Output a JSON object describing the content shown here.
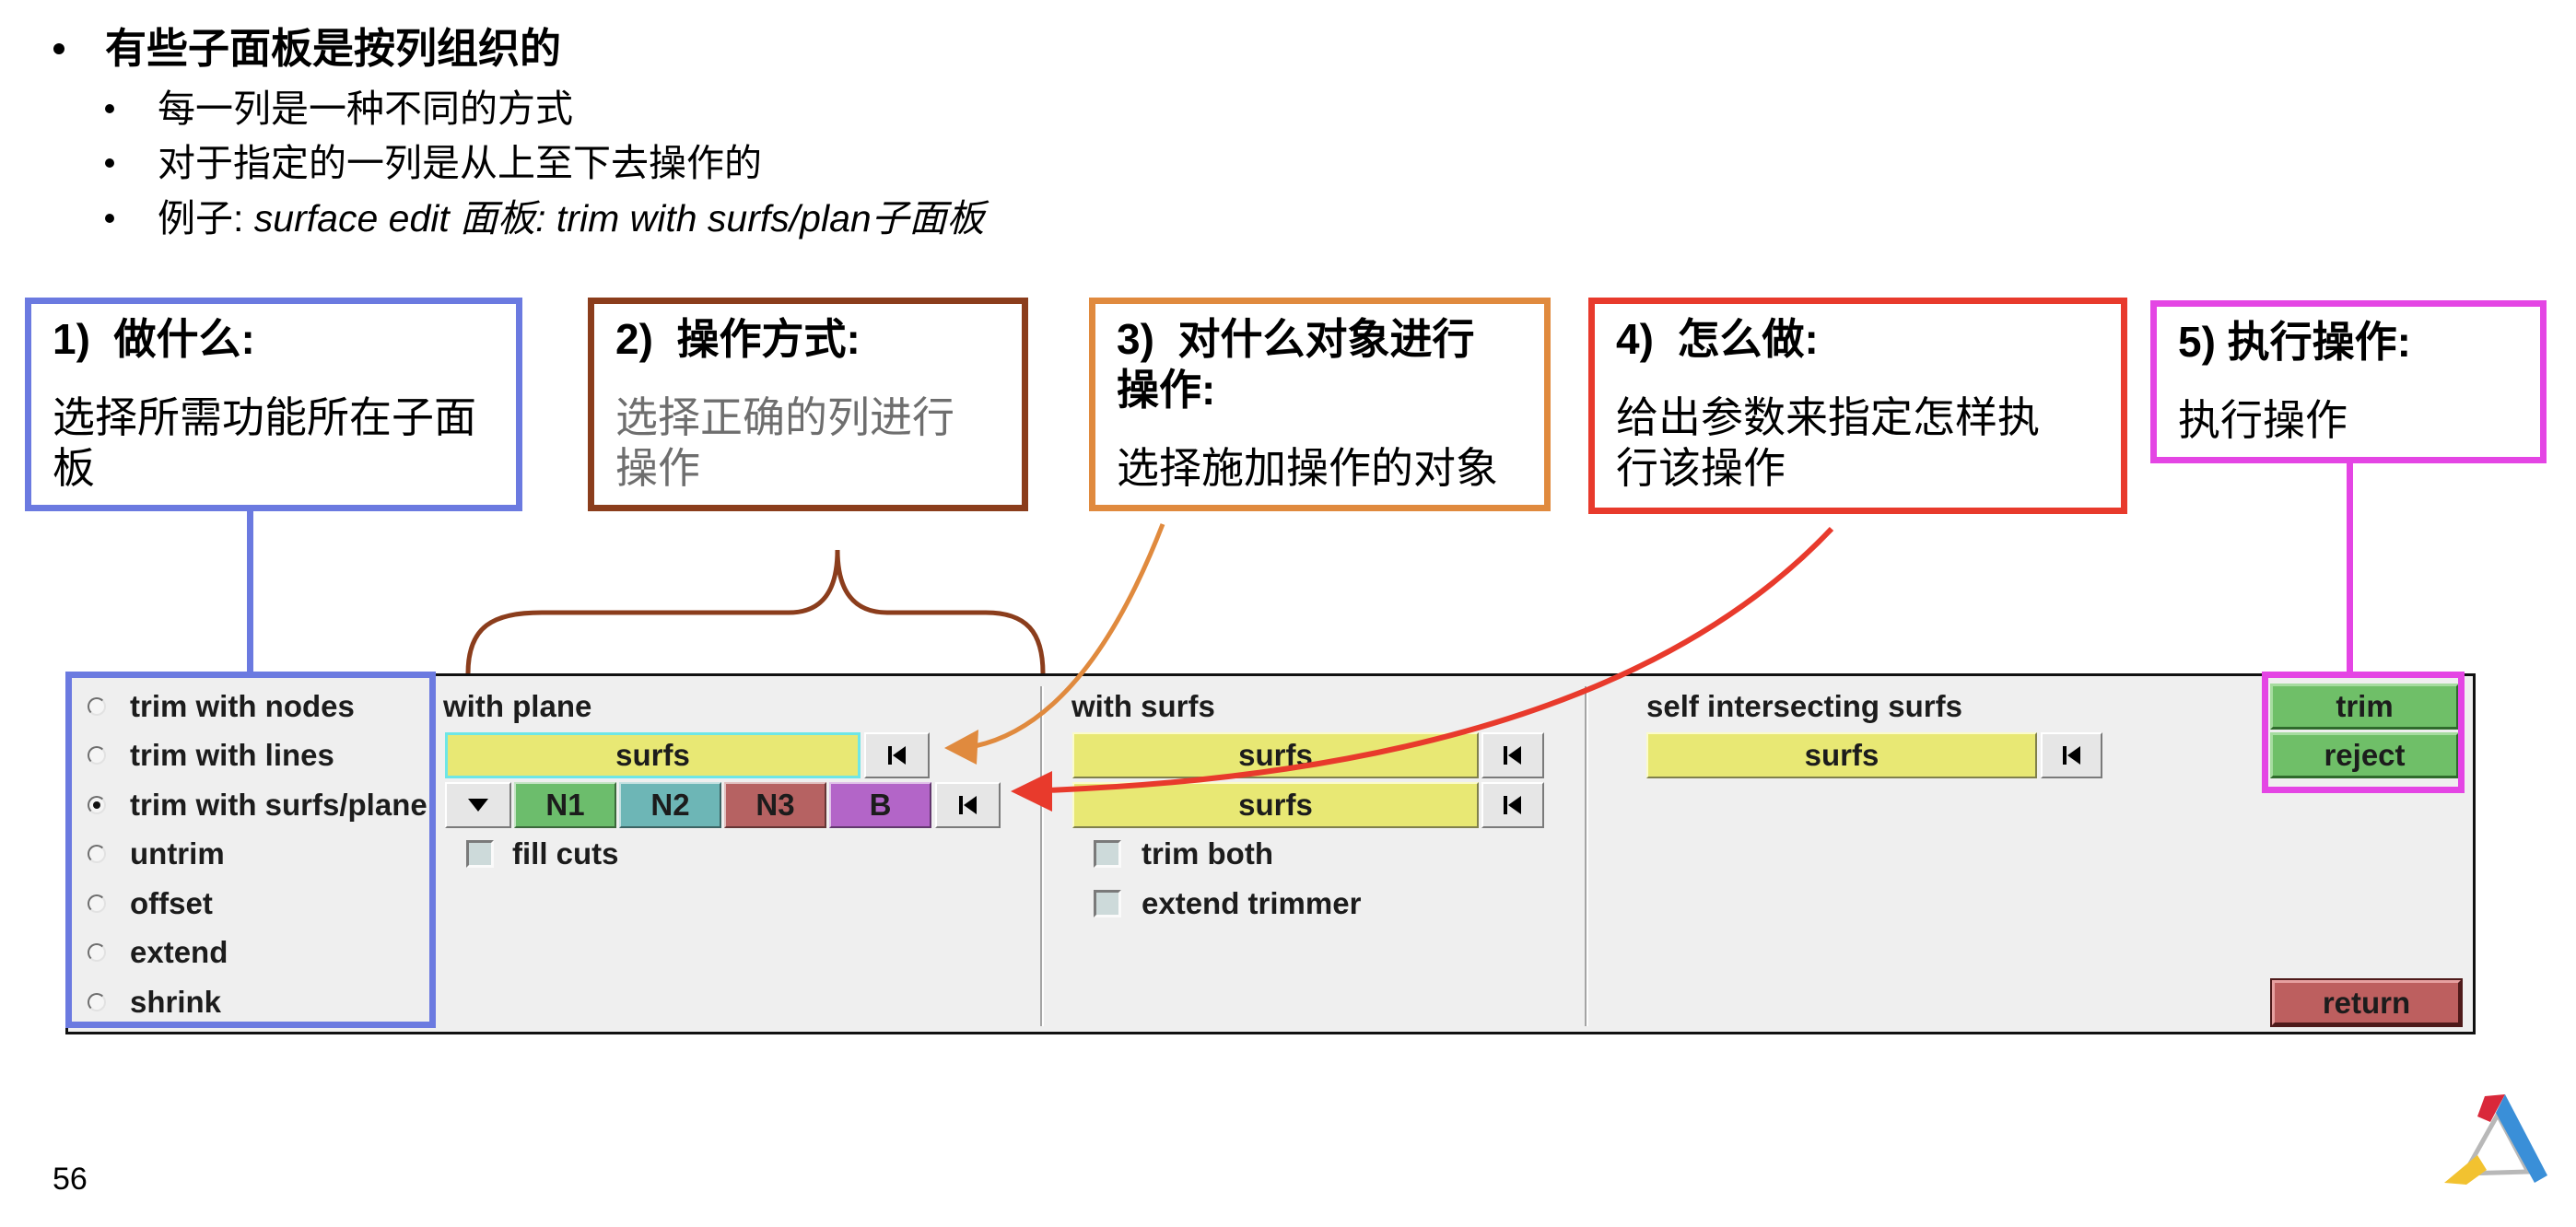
{
  "slide": {
    "bullets": {
      "main": "有些子面板是按列组织的",
      "sub": [
        "每一列是一种不同的方式",
        "对于指定的一列是从上至下去操作的"
      ],
      "example": {
        "prefix": "例子: ",
        "italic": "surface edit 面板: trim with surfs/plan子面板"
      }
    },
    "callouts": [
      {
        "heading": "1)  做什么:",
        "body": "选择所需功能所在子面板",
        "color": "#6b7ae0"
      },
      {
        "heading": "2)  操作方式:",
        "body": "选择正确的列进行操作",
        "color": "#8b3d1c",
        "body_color": "#6e6e6e"
      },
      {
        "heading": "3)  对什么对象进行操作:",
        "body": "选择施加操作的对象",
        "color": "#e08a3e"
      },
      {
        "heading": "4)  怎么做:",
        "body": "给出参数来指定怎样执行该操作",
        "color": "#e83a2c"
      },
      {
        "heading": "5) 执行操作:",
        "body": "执行操作",
        "color": "#e445e4"
      }
    ],
    "page_number": "56",
    "logo": "altair-logo-icon"
  },
  "panel": {
    "radio_options": [
      {
        "label": "trim with nodes",
        "selected": false
      },
      {
        "label": "trim with lines",
        "selected": false
      },
      {
        "label": "trim with surfs/plane",
        "selected": true
      },
      {
        "label": "untrim",
        "selected": false
      },
      {
        "label": "offset",
        "selected": false
      },
      {
        "label": "extend",
        "selected": false
      },
      {
        "label": "shrink",
        "selected": false
      }
    ],
    "columns": {
      "with_plane": {
        "title": "with plane",
        "selector": "surfs",
        "plane_options": [
          "N1",
          "N2",
          "N3",
          "B"
        ],
        "checkboxes": [
          {
            "label": "fill cuts",
            "checked": false
          }
        ]
      },
      "with_surfs": {
        "title": "with surfs",
        "selectors": [
          "surfs",
          "surfs"
        ],
        "checkboxes": [
          {
            "label": "trim both",
            "checked": false
          },
          {
            "label": "extend trimmer",
            "checked": false
          }
        ]
      },
      "self_intersecting": {
        "title": "self intersecting surfs",
        "selectors": [
          "surfs"
        ]
      }
    },
    "actions": {
      "trim": "trim",
      "reject": "reject",
      "return": "return"
    },
    "icons": {
      "reset": "reset-icon",
      "dropdown": "triangle-down-icon",
      "radio": "radio-button-icon",
      "checkbox": "checkbox-icon"
    },
    "colors": {
      "background": "#efefef",
      "selector": "#e8e874",
      "focus": "#6ee6e6",
      "n1": "#6cbd6c",
      "n2": "#6db6b6",
      "n3": "#b66262",
      "b": "#b365c8",
      "action": "#6fbf68",
      "return": "#bd5f5f"
    }
  }
}
